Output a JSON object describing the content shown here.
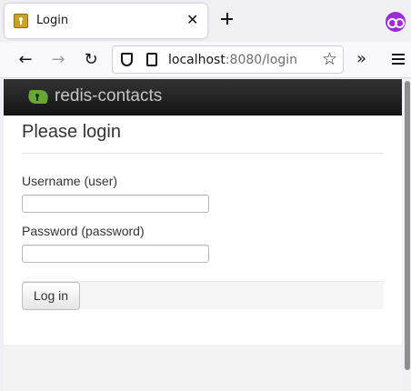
{
  "browser": {
    "tab": {
      "title": "Login",
      "favicon": "lock-favicon-icon",
      "close_icon": "close-icon"
    },
    "new_tab_icon": "plus-icon",
    "extension_icon": "private-browsing-mask-icon",
    "nav": {
      "back_icon": "arrow-left-icon",
      "forward_icon": "arrow-right-icon",
      "reload_icon": "reload-icon",
      "overflow_icon": "chevron-double-right-icon",
      "menu_icon": "hamburger-menu-icon"
    },
    "url": {
      "host": "localhost",
      "rest": ":8080/login"
    },
    "bookmark_icon": "star-icon",
    "accent_color": "#9a2bd6"
  },
  "app": {
    "brand": "redis-contacts",
    "brand_color": "#6aa632",
    "heading": "Please login",
    "form": {
      "username_label": "Username (user)",
      "username_value": "",
      "password_label": "Password (password)",
      "password_value": "",
      "submit_label": "Log in"
    }
  }
}
